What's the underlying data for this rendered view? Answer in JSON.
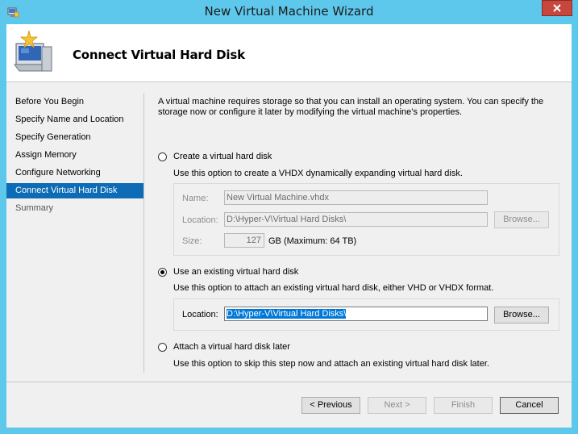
{
  "window": {
    "title": "New Virtual Machine Wizard",
    "accent": "#5ec8ec",
    "close_color": "#c7463e"
  },
  "header": {
    "title": "Connect Virtual Hard Disk",
    "icon": "virtual-machine-wizard-icon"
  },
  "nav": {
    "items": [
      {
        "label": "Before You Begin"
      },
      {
        "label": "Specify Name and Location"
      },
      {
        "label": "Specify Generation"
      },
      {
        "label": "Assign Memory"
      },
      {
        "label": "Configure Networking"
      },
      {
        "label": "Connect Virtual Hard Disk"
      },
      {
        "label": "Summary"
      }
    ],
    "active_color": "#0d6cb5"
  },
  "content": {
    "description_line1": "A virtual machine requires storage so that you can install an operating system. You can specify the",
    "description_line2": "storage now or configure it later by modifying the virtual machine’s properties.",
    "create": {
      "label": "Create a virtual hard disk",
      "subtext": "Use this option to create a VHDX dynamically expanding virtual hard disk.",
      "name_label": "Name:",
      "name_value": "New Virtual Machine.vhdx",
      "location_label": "Location:",
      "location_value": "D:\\Hyper-V\\Virtual Hard Disks\\",
      "browse_label": "Browse...",
      "size_label": "Size:",
      "size_value": "127",
      "size_suffix": "GB (Maximum: 64 TB)"
    },
    "existing": {
      "label": "Use an existing virtual hard disk",
      "subtext": "Use this option to attach an existing virtual hard disk, either VHD or VHDX format.",
      "location_label": "Location:",
      "location_value": "D:\\Hyper-V\\Virtual Hard Disks\\",
      "browse_label": "Browse..."
    },
    "later": {
      "label": "Attach a virtual hard disk later",
      "subtext": "Use this option to skip this step now and attach an existing virtual hard disk later."
    }
  },
  "footer": {
    "previous": "< Previous",
    "next": "Next >",
    "finish": "Finish",
    "cancel": "Cancel"
  }
}
